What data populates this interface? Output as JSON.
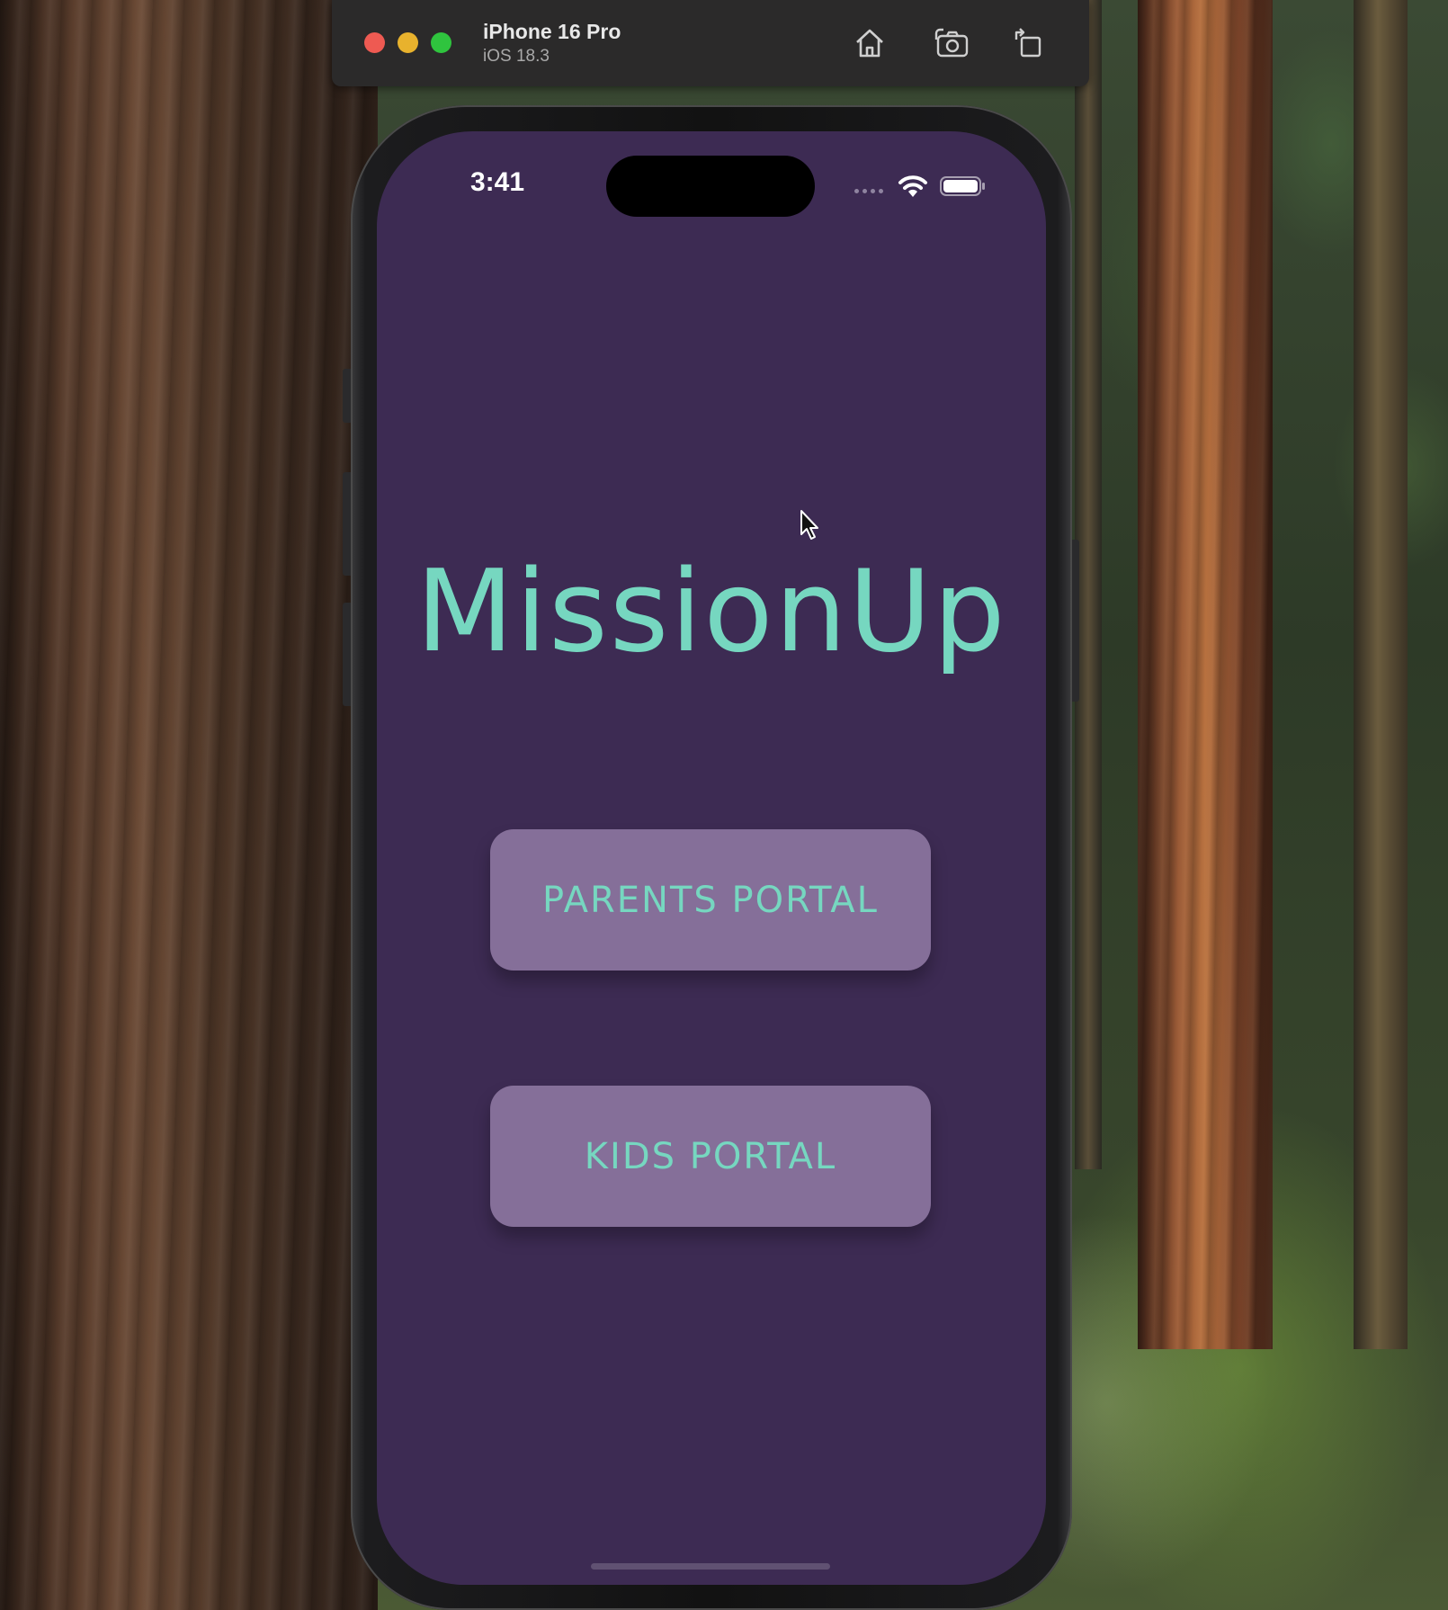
{
  "simulator": {
    "device_name": "iPhone 16 Pro",
    "os_version": "iOS 18.3",
    "icons": [
      "home-icon",
      "screenshot-icon",
      "rotate-icon"
    ]
  },
  "status_bar": {
    "time": "3:41",
    "icons": [
      "signal-icon",
      "wifi-icon",
      "battery-icon"
    ]
  },
  "app": {
    "title": "MissionUp",
    "buttons": {
      "parents_portal": "PARENTS PORTAL",
      "kids_portal": "KIDS PORTAL"
    }
  },
  "colors": {
    "screen_background": "#3d2b53",
    "accent_teal": "#76d7c0",
    "button_background": "#856f99",
    "simulator_bar": "#2b2a2a"
  }
}
